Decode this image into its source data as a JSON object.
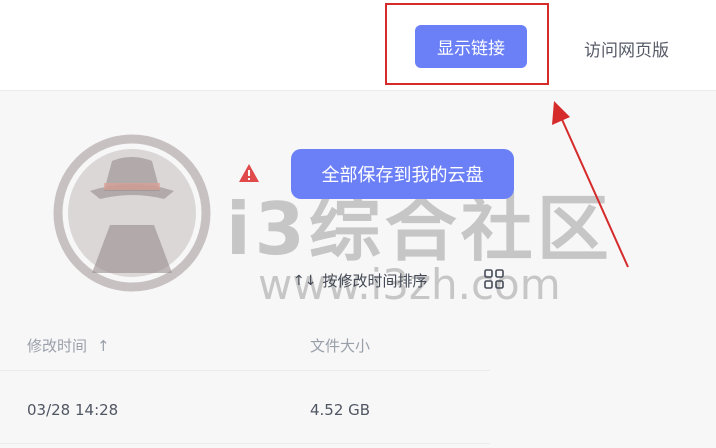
{
  "header": {
    "show_link_label": "显示链接",
    "visit_web_label": "访问网页版"
  },
  "main": {
    "save_all_label": "全部保存到我的云盘",
    "sort_label": "按修改时间排序",
    "sort_icon": "↑↓"
  },
  "table": {
    "columns": [
      "修改时间",
      "文件大小"
    ],
    "sort_indicator": "↑",
    "rows": [
      {
        "modified": "03/28 14:28",
        "size": "4.52 GB"
      }
    ]
  },
  "watermark": {
    "text": "i3综合社区",
    "url": "www.i3zh.com"
  },
  "colors": {
    "accent": "#6b7ff6",
    "highlight": "#d52b2b"
  }
}
